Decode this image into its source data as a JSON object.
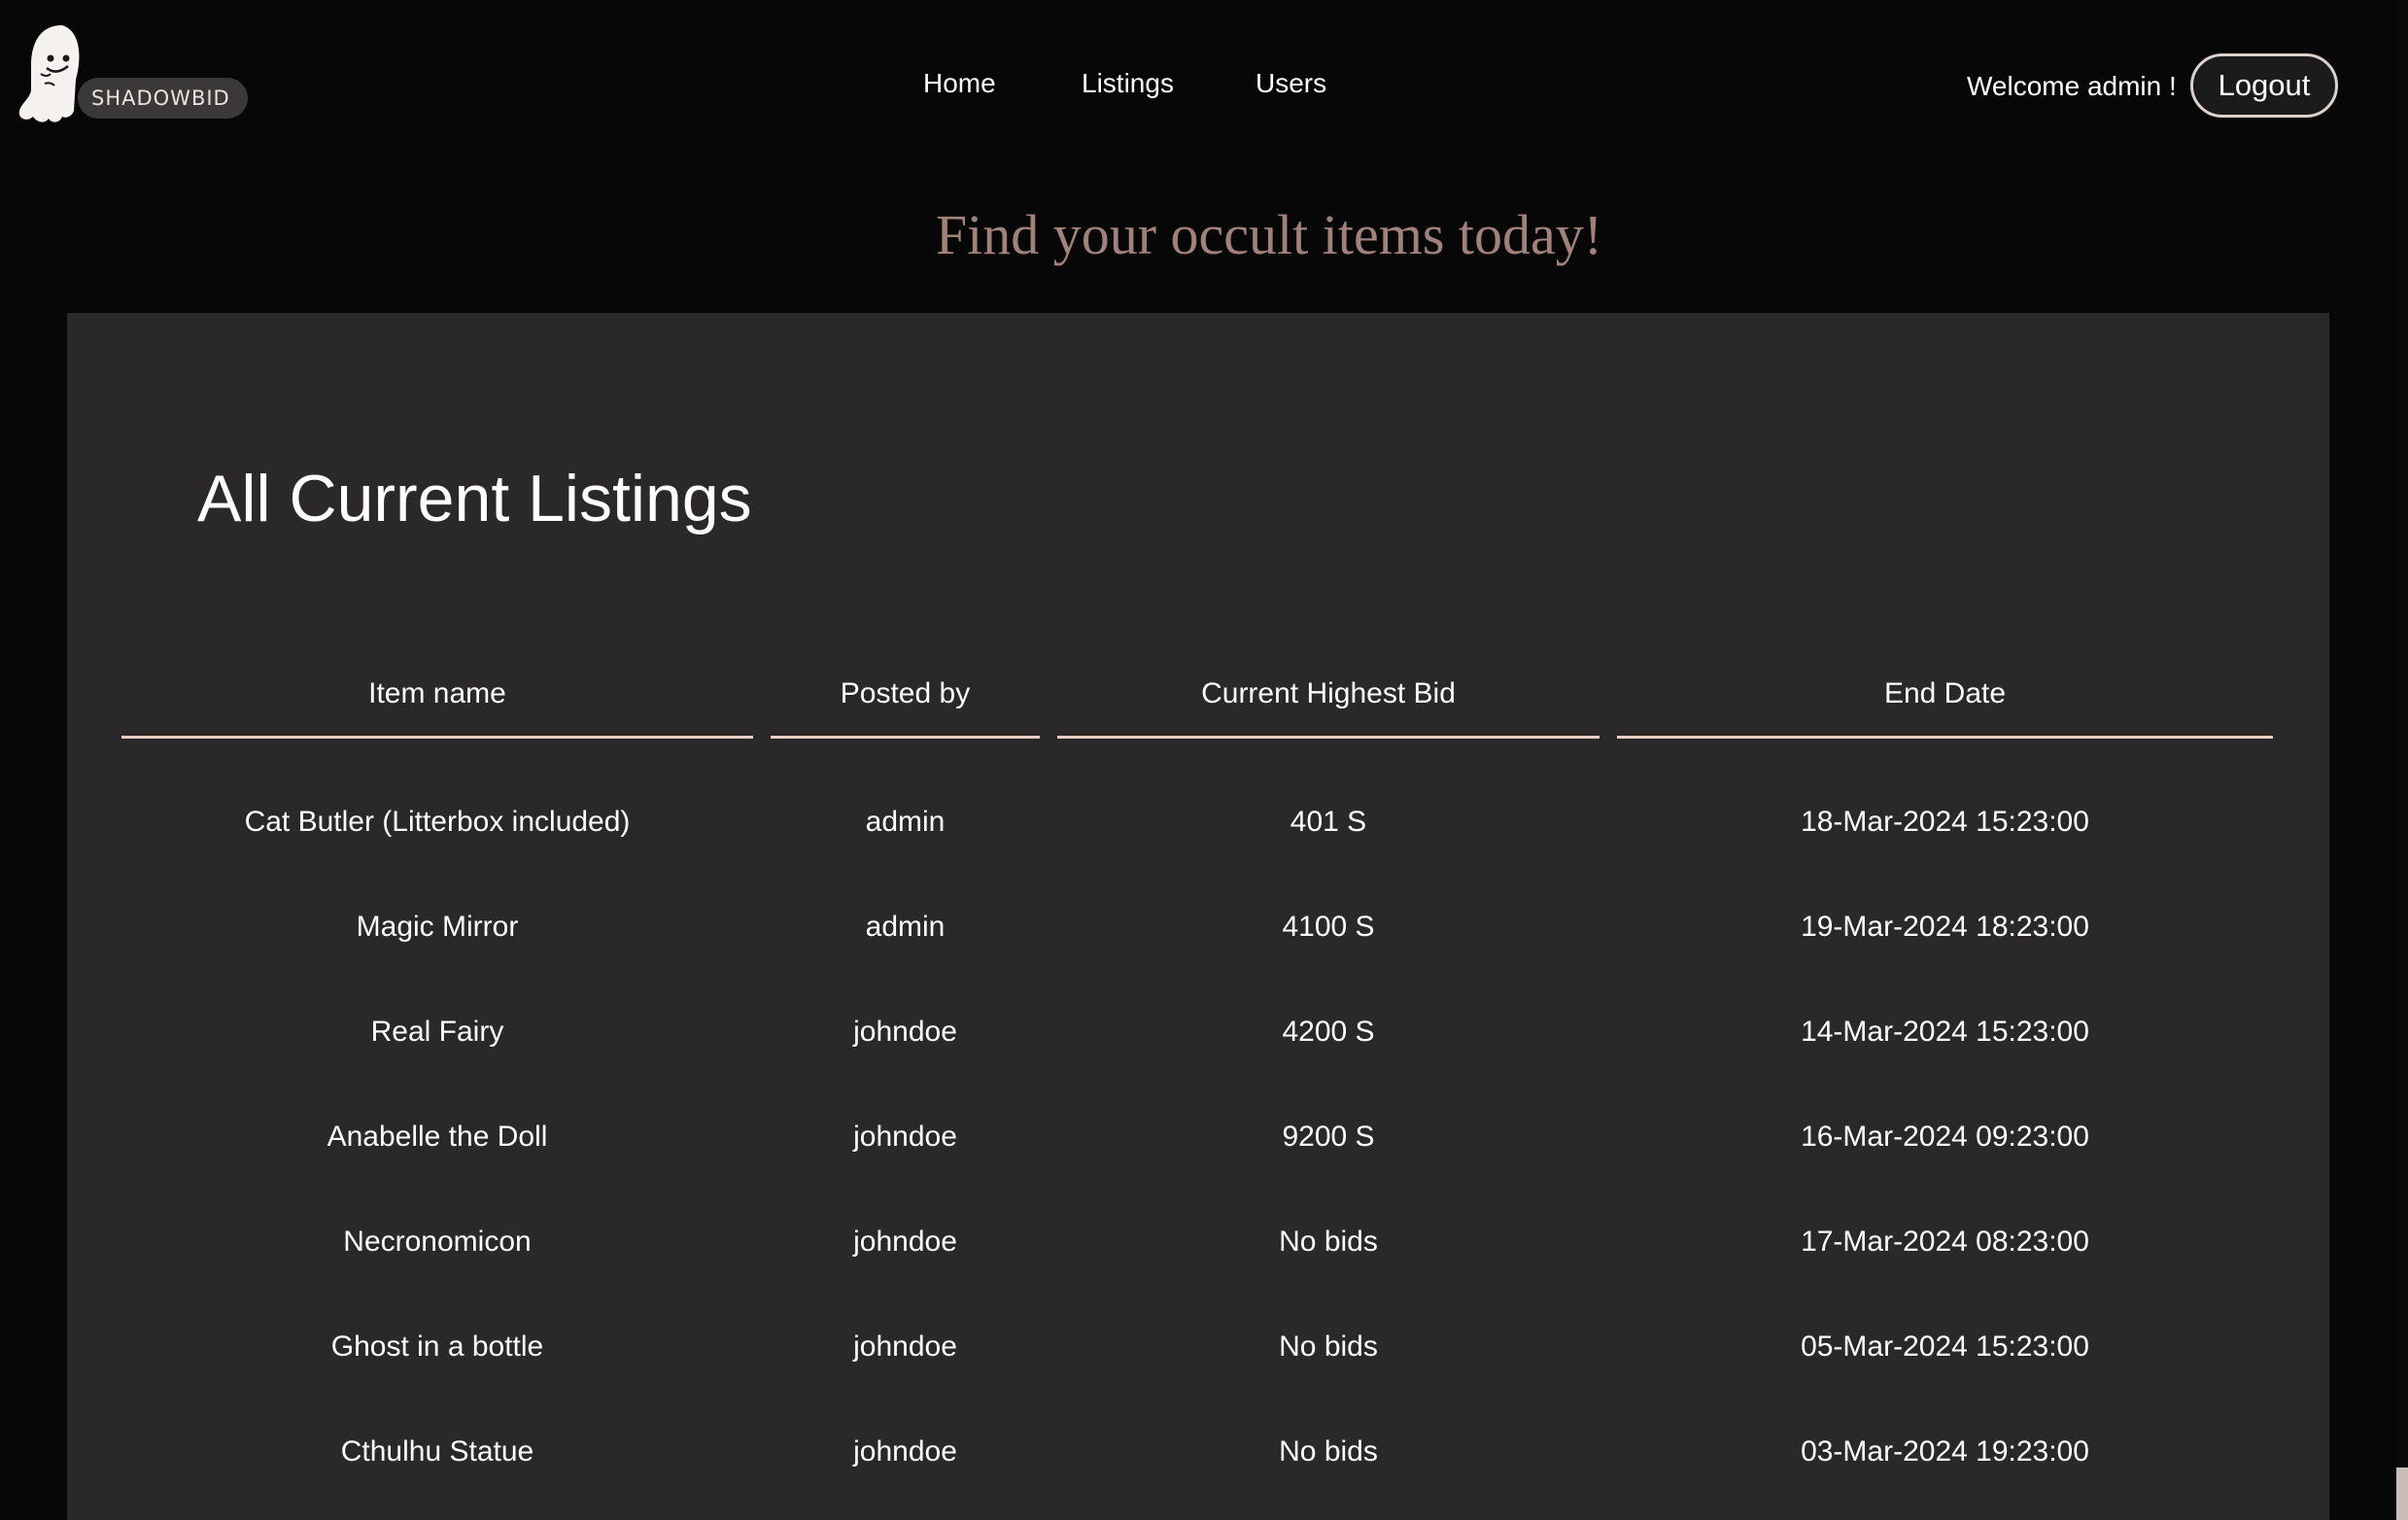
{
  "brand": {
    "name": "SHADOWBID"
  },
  "nav": {
    "home": "Home",
    "listings": "Listings",
    "users": "Users"
  },
  "user": {
    "welcome": "Welcome admin !",
    "logout_label": "Logout"
  },
  "hero": {
    "title": "Find your occult items today!"
  },
  "listings": {
    "title": "All Current Listings",
    "columns": [
      "Item name",
      "Posted by",
      "Current Highest Bid",
      "End Date"
    ],
    "rows": [
      {
        "item": "Cat Butler (Litterbox included)",
        "posted_by": "admin",
        "bid": "401 S",
        "end": "18-Mar-2024 15:23:00"
      },
      {
        "item": "Magic Mirror",
        "posted_by": "admin",
        "bid": "4100 S",
        "end": "19-Mar-2024 18:23:00"
      },
      {
        "item": "Real Fairy",
        "posted_by": "johndoe",
        "bid": "4200 S",
        "end": "14-Mar-2024 15:23:00"
      },
      {
        "item": "Anabelle the Doll",
        "posted_by": "johndoe",
        "bid": "9200 S",
        "end": "16-Mar-2024 09:23:00"
      },
      {
        "item": "Necronomicon",
        "posted_by": "johndoe",
        "bid": "No bids",
        "end": "17-Mar-2024 08:23:00"
      },
      {
        "item": "Ghost in a bottle",
        "posted_by": "johndoe",
        "bid": "No bids",
        "end": "05-Mar-2024 15:23:00"
      },
      {
        "item": "Cthulhu Statue",
        "posted_by": "johndoe",
        "bid": "No bids",
        "end": "03-Mar-2024 19:23:00"
      }
    ]
  },
  "colors": {
    "background": "#080707",
    "panel": "#2a2829",
    "accent_title": "#a0827a",
    "header_rule": "#e8cfc2"
  }
}
